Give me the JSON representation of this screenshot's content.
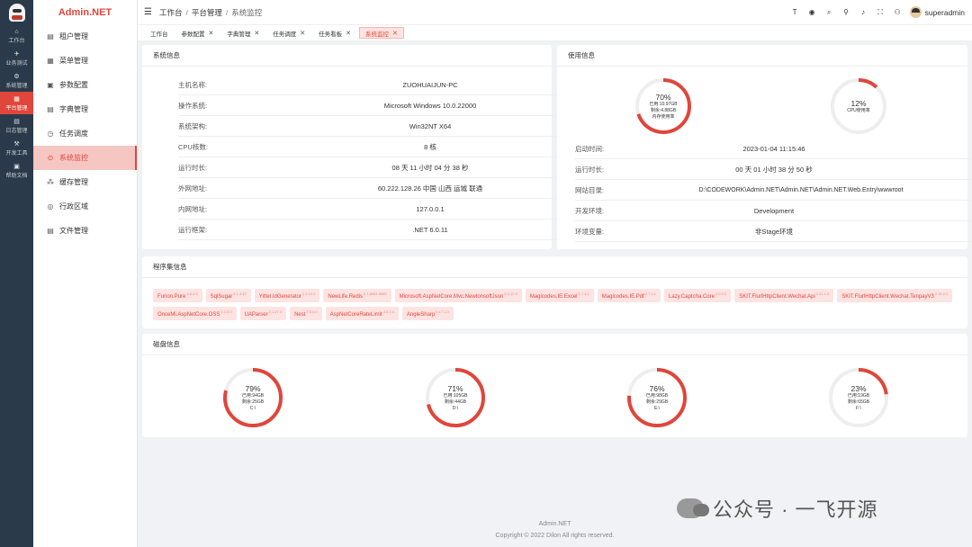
{
  "colors": {
    "accent": "#e0463b",
    "rail_bg": "#2b3a4a",
    "gauge_track": "#eeeeee"
  },
  "rail": {
    "items": [
      {
        "label": "工作台",
        "icon": "home-icon",
        "glyph": "⌂",
        "active": false
      },
      {
        "label": "业务测试",
        "icon": "send-icon",
        "glyph": "✈",
        "active": false
      },
      {
        "label": "系统管理",
        "icon": "gear-icon",
        "glyph": "⚙",
        "active": false
      },
      {
        "label": "平台管理",
        "icon": "grid-icon",
        "glyph": "▦",
        "active": true
      },
      {
        "label": "日志管理",
        "icon": "document-icon",
        "glyph": "▤",
        "active": false
      },
      {
        "label": "开发工具",
        "icon": "tool-icon",
        "glyph": "⚒",
        "active": false
      },
      {
        "label": "帮助文档",
        "icon": "book-icon",
        "glyph": "▣",
        "active": false
      }
    ]
  },
  "sidebar": {
    "title": "Admin.NET",
    "items": [
      {
        "label": "租户管理",
        "icon": "tenant-icon",
        "glyph": "▤",
        "active": false
      },
      {
        "label": "菜单管理",
        "icon": "menu-icon",
        "glyph": "▦",
        "active": false
      },
      {
        "label": "参数配置",
        "icon": "config-icon",
        "glyph": "▣",
        "active": false
      },
      {
        "label": "字典管理",
        "icon": "dictionary-icon",
        "glyph": "▤",
        "active": false
      },
      {
        "label": "任务调度",
        "icon": "schedule-icon",
        "glyph": "◷",
        "active": false
      },
      {
        "label": "系统监控",
        "icon": "monitor-icon",
        "glyph": "⊙",
        "active": true
      },
      {
        "label": "缓存管理",
        "icon": "cache-icon",
        "glyph": "⁂",
        "active": false
      },
      {
        "label": "行政区域",
        "icon": "location-icon",
        "glyph": "◎",
        "active": false
      },
      {
        "label": "文件管理",
        "icon": "file-icon",
        "glyph": "▤",
        "active": false
      }
    ]
  },
  "header": {
    "breadcrumbs": [
      "工作台",
      "平台管理",
      "系统监控"
    ],
    "separator": "/",
    "username": "superadmin",
    "icons": [
      {
        "name": "font-size-icon",
        "glyph": "T"
      },
      {
        "name": "target-icon",
        "glyph": "◉"
      },
      {
        "name": "search-icon",
        "glyph": "⌕"
      },
      {
        "name": "shirt-icon",
        "glyph": "⚲"
      },
      {
        "name": "bell-icon",
        "glyph": "♪"
      },
      {
        "name": "fullscreen-icon",
        "glyph": "⛶"
      },
      {
        "name": "user-icon",
        "glyph": "⚇"
      }
    ]
  },
  "tabs": [
    {
      "label": "工作台",
      "closable": false,
      "active": false
    },
    {
      "label": "参数配置",
      "closable": true,
      "active": false
    },
    {
      "label": "字典管理",
      "closable": true,
      "active": false
    },
    {
      "label": "任务调度",
      "closable": true,
      "active": false
    },
    {
      "label": "任务看板",
      "closable": true,
      "active": false
    },
    {
      "label": "系统监控",
      "closable": true,
      "active": true
    }
  ],
  "system_info": {
    "title": "系统信息",
    "rows": [
      {
        "key": "主机名称:",
        "value": "ZUOHUAIJUN-PC"
      },
      {
        "key": "操作系统:",
        "value": "Microsoft Windows 10.0.22000"
      },
      {
        "key": "系统架构:",
        "value": "Win32NT X64"
      },
      {
        "key": "CPU核数:",
        "value": "8 核"
      },
      {
        "key": "运行时长:",
        "value": "08 天 11 小时 04 分 38 秒"
      },
      {
        "key": "外网地址:",
        "value": "60.222.128.26 中国 山西 运城 联通"
      },
      {
        "key": "内网地址:",
        "value": "127.0.0.1"
      },
      {
        "key": "运行框架:",
        "value": ".NET 6.0.11"
      }
    ]
  },
  "usage_info": {
    "title": "使用信息",
    "memory": {
      "percent": 70,
      "pct_label": "70%",
      "line1": "已用:10.97GB",
      "line2": "剩余:4.88GB",
      "line3": "内存使用率"
    },
    "cpu": {
      "percent": 12,
      "pct_label": "12%",
      "line1": "CPU使用率"
    },
    "rows": [
      {
        "key": "启动时间:",
        "value": "2023-01-04 11:15:46"
      },
      {
        "key": "运行时长:",
        "value": "00 天 01 小时 38 分 50 秒"
      },
      {
        "key": "网站目录:",
        "value": "D:\\CODEWORK\\Admin.NET\\Admin.NET\\Admin.NET.Web.Entry\\wwwroot"
      },
      {
        "key": "开发环境:",
        "value": "Development"
      },
      {
        "key": "环境变量:",
        "value": "非Stage环境"
      }
    ]
  },
  "assemblies": {
    "title": "程序集信息",
    "items": [
      {
        "name": "Furion.Pure",
        "version": "4.8.4.5"
      },
      {
        "name": "SqlSugar",
        "version": "5.1.3.42"
      },
      {
        "name": "Yitter.IdGenerator",
        "version": "1.0.14.0"
      },
      {
        "name": "NewLife.Redis",
        "version": "5.1.8491.5869"
      },
      {
        "name": "Microsoft.AspNetCore.Mvc.NewtonsoftJson",
        "version": "6.0.12.0"
      },
      {
        "name": "Magicodes.IE.Excel",
        "version": "2.7.4.1"
      },
      {
        "name": "Magicodes.IE.Pdf",
        "version": "2.7.4.1"
      },
      {
        "name": "Lazy.Captcha.Core",
        "version": "2.0.0.0"
      },
      {
        "name": "SKIT.FlurlHttpClient.Wechat.Api",
        "version": "2.21.1.0"
      },
      {
        "name": "SKIT.FlurlHttpClient.Wechat.TenpayV3",
        "version": "2.15.2.0"
      },
      {
        "name": "OnceMi.AspNetCore.OSS",
        "version": "1.1.9.0"
      },
      {
        "name": "UAParser",
        "version": "3.1.47.0"
      },
      {
        "name": "Nest",
        "version": "7.0.0.0"
      },
      {
        "name": "AspNetCoreRateLimit",
        "version": "4.0.2.0"
      },
      {
        "name": "AngleSharp",
        "version": "0.17.1.0"
      }
    ]
  },
  "disk_info": {
    "title": "磁盘信息",
    "disks": [
      {
        "percent": 79,
        "pct_label": "79%",
        "used": "已用:94GB",
        "free": "剩余:25GB",
        "drive": "C:\\"
      },
      {
        "percent": 71,
        "pct_label": "71%",
        "used": "已用:105GB",
        "free": "剩余:44GB",
        "drive": "D:\\"
      },
      {
        "percent": 76,
        "pct_label": "76%",
        "used": "已用:98GB",
        "free": "剩余:29GB",
        "drive": "E:\\"
      },
      {
        "percent": 23,
        "pct_label": "23%",
        "used": "已用:19GB",
        "free": "剩余:65GB",
        "drive": "F:\\"
      }
    ]
  },
  "footer": {
    "line1": "Admin.NET",
    "line2": "Copyright © 2022 Dilon All rights reserved."
  },
  "watermark": {
    "text": "公众号 · 一飞开源"
  }
}
